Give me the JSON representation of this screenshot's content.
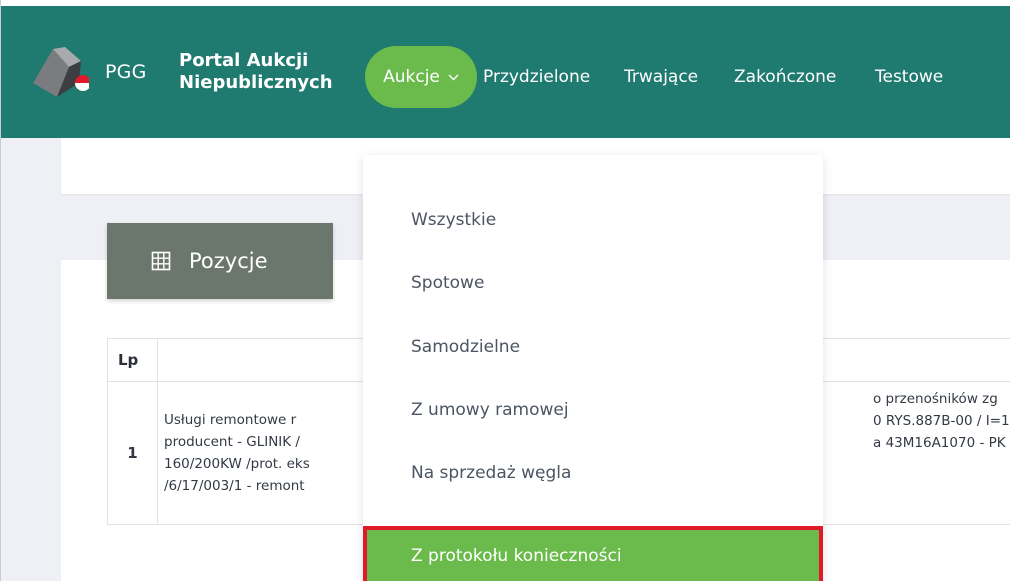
{
  "navbar": {
    "brand": "PGG",
    "portal_title_line1": "Portal Aukcji",
    "portal_title_line2": "Niepublicznych",
    "active_menu": "Aukcje",
    "links": [
      "Przydzielone",
      "Trwające",
      "Zakończone",
      "Testowe"
    ],
    "bg_color": "#1f7a70",
    "accent_color": "#6bbb4c"
  },
  "positions_tab": {
    "icon": "grid-table-icon",
    "label": "Pozycje"
  },
  "table": {
    "header_lp": "Lp",
    "rows": [
      {
        "lp": "1",
        "description_lines": [
          "Usługi remontowe r",
          "producent - GLINIK /",
          "160/200KW /prot. eks",
          "/6/17/003/1 - remont"
        ],
        "description_right_lines": [
          "o przenośników zg",
          "0 RYS.887B-00 / I=1!",
          "a 43M16A1070 - PK"
        ]
      }
    ]
  },
  "dropdown": {
    "items": [
      "Wszystkie",
      "Spotowe",
      "Samodzielne",
      "Z umowy ramowej",
      "Na sprzedaż węgla"
    ],
    "highlighted_item": "Z protokołu konieczności",
    "highlight_border_color": "#e0192b"
  }
}
